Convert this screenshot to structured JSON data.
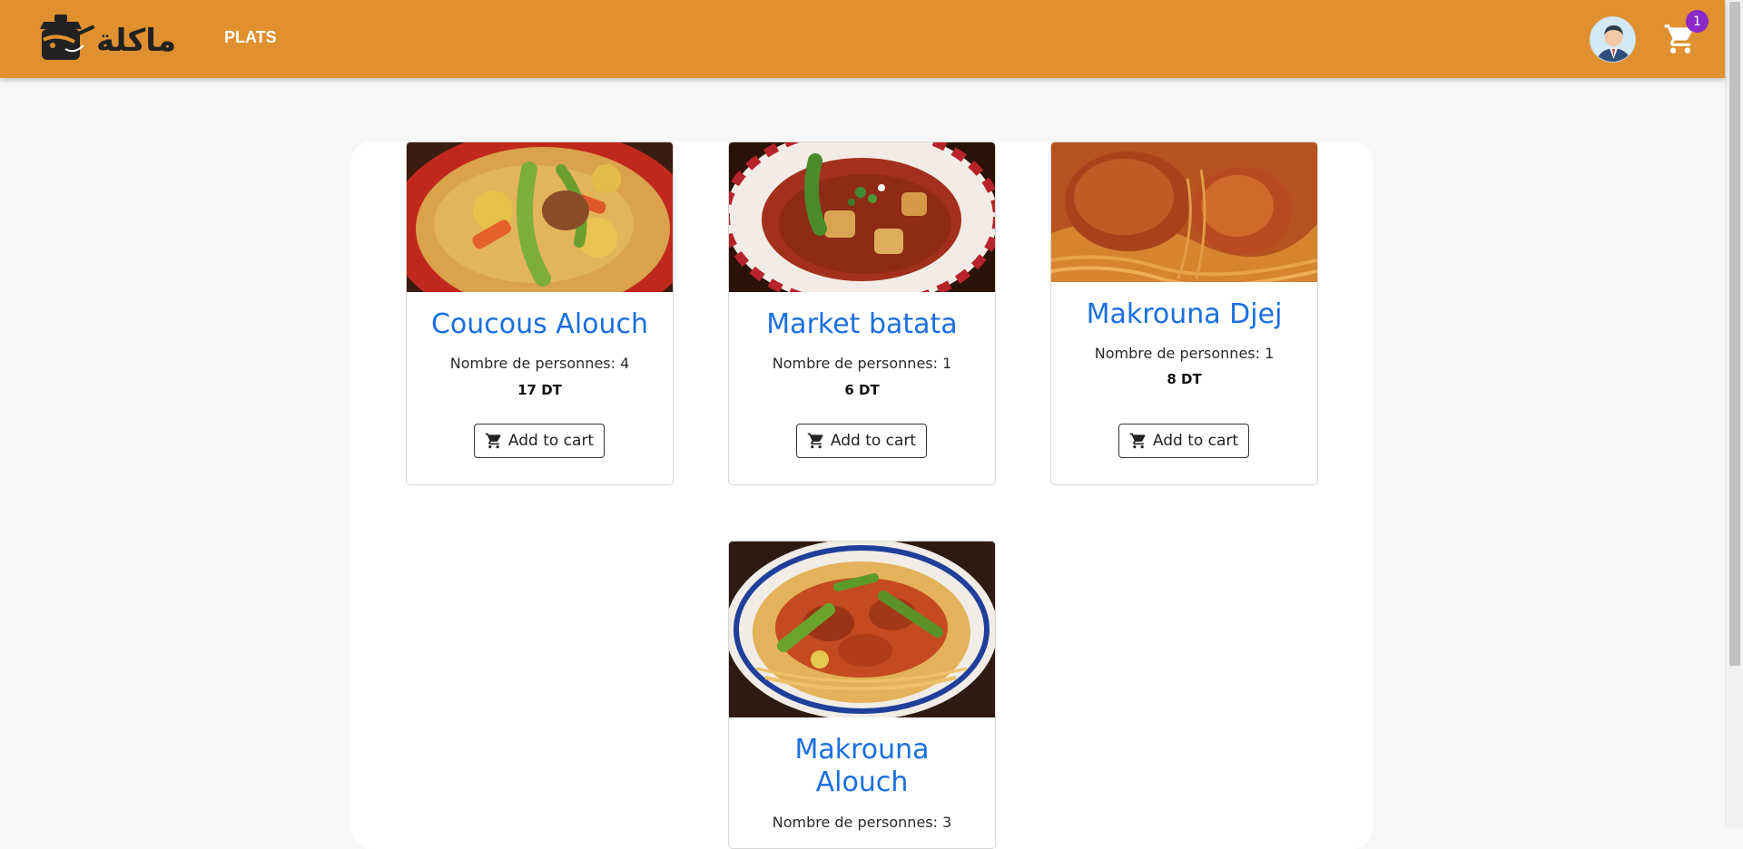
{
  "navbar": {
    "brand": "ماكلة",
    "nav_link": "PLATS",
    "cart_count": "1"
  },
  "icons": {
    "logo": "chef-pot-logo-icon",
    "avatar": "user-avatar-icon",
    "cart": "shopping-cart-icon",
    "button": "cart-icon"
  },
  "colors": {
    "navbar": "#e0902e",
    "title": "#1a6fdf",
    "badge": "#8b28c7"
  },
  "dishes": [
    {
      "name": "Coucous Alouch",
      "persons": "Nombre de personnes: 4",
      "price": "17 DT",
      "button": "Add to cart"
    },
    {
      "name": "Market batata",
      "persons": "Nombre de personnes: 1",
      "price": "6 DT",
      "button": "Add to cart"
    },
    {
      "name": "Makrouna Djej",
      "persons": "Nombre de personnes: 1",
      "price": "8 DT",
      "button": "Add to cart"
    },
    {
      "name": "Makrouna Alouch",
      "persons": "Nombre de personnes: 3",
      "price": "",
      "button": ""
    }
  ]
}
